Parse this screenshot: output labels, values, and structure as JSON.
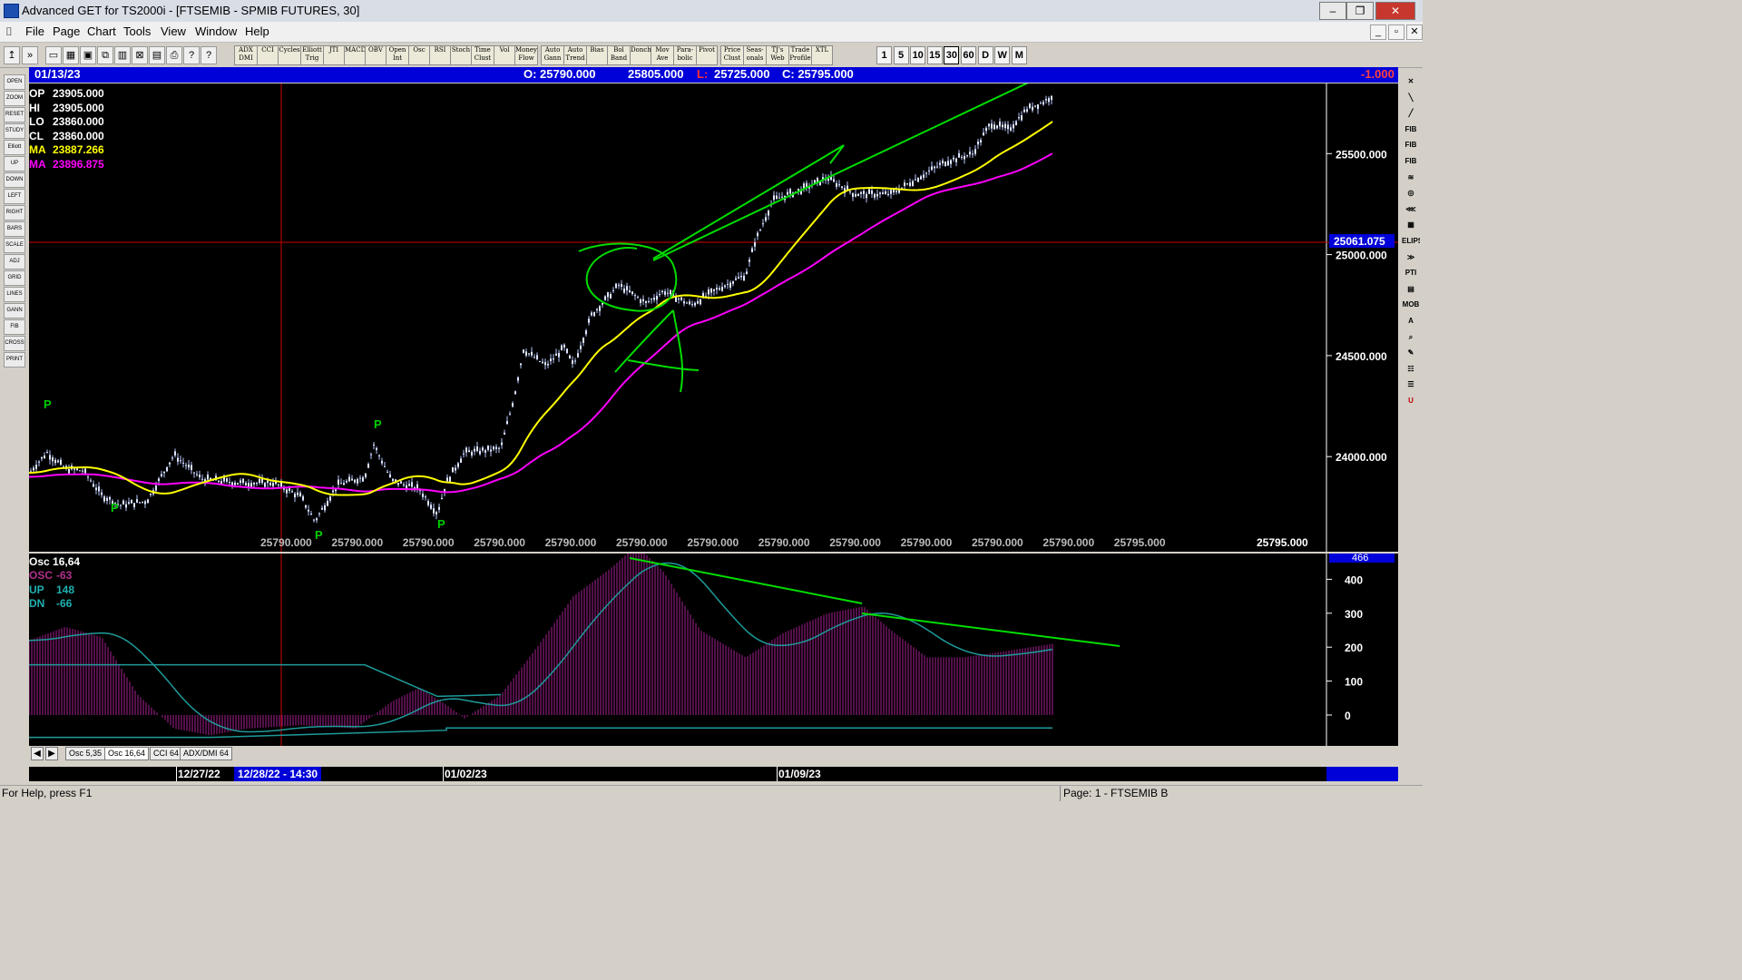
{
  "window": {
    "title": "Advanced GET for TS2000i - [FTSEMIB - SPMIB FUTURES, 30]",
    "minimize": "–",
    "maximize": "❐",
    "close": "✕"
  },
  "menu": {
    "items": [
      "File",
      "Page",
      "Chart",
      "Tools",
      "View",
      "Window",
      "Help"
    ],
    "mdi_min": "_",
    "mdi_restore": "▫",
    "mdi_close": "✕"
  },
  "toolbar": {
    "study_buttons": [
      "ADX DMI",
      "CCI",
      "Cycles",
      "Elliott Trig",
      "JTI",
      "MACD",
      "OBV",
      "Open Int",
      "Osc",
      "RSI",
      "Stoch",
      "Time Clust",
      "Vol",
      "Money Flow",
      "Auto Gann",
      "Auto Trend",
      "Bias",
      "Bol Band",
      "Donch",
      "Mov Ave",
      "Para-bolic",
      "Pivot",
      "Price Clust",
      "Seas-onals",
      "TJ's Web",
      "Trade Profile",
      "XTL"
    ],
    "periods": [
      "1",
      "5",
      "10",
      "15",
      "30",
      "60",
      "D",
      "W",
      "M"
    ],
    "active_period": "30"
  },
  "left_tools": [
    "OPEN",
    "ZOOM",
    "RESET",
    "STUDY",
    "Elliott",
    "UP",
    "DOWN",
    "LEFT",
    "RIGHT",
    "BARS",
    "SCALE",
    "ADJ",
    "GRID",
    "LINES",
    "GANN",
    "FIB",
    "CROSS",
    "PRINT"
  ],
  "right_tools": [
    "✕",
    "╲",
    "╱",
    "FIB RET",
    "FIB EXT",
    "FIB TIME",
    "≋",
    "◎",
    "⋘",
    "▦",
    "ELIPS",
    "≫",
    "PTI",
    "▤",
    "MOB",
    "A",
    "⌕",
    "✎",
    "☷",
    "☰",
    "U"
  ],
  "infobar": {
    "date": "01/13/23",
    "open": "O: 25790.000",
    "high": "25805.000",
    "low_label": "L:",
    "low": "25725.000",
    "close": "C: 25795.000",
    "change": "-1.000"
  },
  "price_panel": {
    "readout": [
      {
        "label": "OP",
        "value": "23905.000",
        "color": "#ffffff"
      },
      {
        "label": "HI",
        "value": "23905.000",
        "color": "#ffffff"
      },
      {
        "label": "LO",
        "value": "23860.000",
        "color": "#ffffff"
      },
      {
        "label": "CL",
        "value": "23860.000",
        "color": "#ffffff"
      },
      {
        "label": "MA",
        "value": "23887.266",
        "color": "#ffff00"
      },
      {
        "label": "MA",
        "value": "23896.875",
        "color": "#ff00ff"
      }
    ],
    "y_ticks": [
      "25500.000",
      "25000.000",
      "24500.000",
      "24000.000"
    ],
    "crosshair_price": "25061.075",
    "bottom_values": [
      "25790.000",
      "25790.000",
      "25790.000",
      "25790.000",
      "25790.000",
      "25790.000",
      "25790.000",
      "25790.000",
      "25790.000",
      "25790.000",
      "25790.000",
      "25790.000",
      "25795.000",
      "25795.000"
    ],
    "pivot_markers": [
      "P",
      "P",
      "P",
      "P",
      "P"
    ]
  },
  "osc_panel": {
    "title": "Osc 16,64",
    "legend": [
      {
        "label": "OSC",
        "value": "-63",
        "color": "#b0308c"
      },
      {
        "label": "UP",
        "value": "148",
        "color": "#20b0b0"
      },
      {
        "label": "DN",
        "value": "-66",
        "color": "#20b0b0"
      }
    ],
    "y_ticks": [
      "400",
      "300",
      "200",
      "100",
      "0"
    ],
    "current_value": "466"
  },
  "osc_tabs": [
    "Osc 5,35",
    "Osc 16,64",
    "CCI 64",
    "ADX/DMI 64"
  ],
  "active_osc_tab": "Osc 16,64",
  "dates": {
    "d1": "12/27/22",
    "d2": "12/28/22 - 14:30",
    "d3": "01/02/23",
    "d4": "01/09/23"
  },
  "status": {
    "help": "For Help, press F1",
    "page": "Page: 1 - FTSEMIB B"
  },
  "colors": {
    "ma_fast": "#ffff00",
    "ma_slow": "#ff00ff",
    "trendline": "#00dd00",
    "crosshair": "#cc0000",
    "bars": "#b8c8ff",
    "osc_hist": "#8c1a7a",
    "osc_line": "#1f9a9a"
  }
}
